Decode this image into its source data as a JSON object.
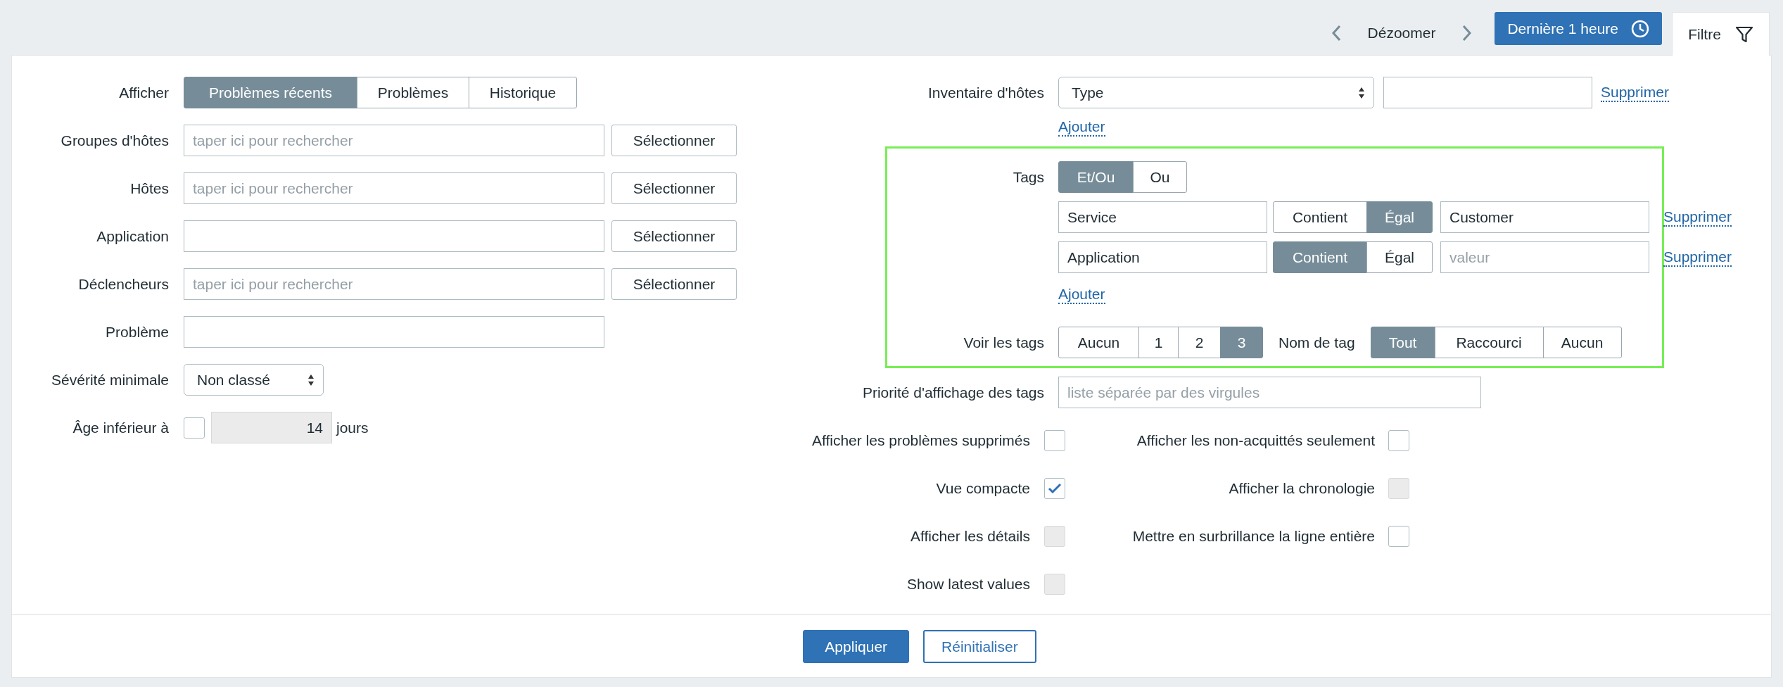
{
  "header": {
    "zoom_out": "Dézoomer",
    "time_range": "Dernière 1 heure",
    "filter_tab": "Filtre"
  },
  "left": {
    "show": {
      "label": "Afficher",
      "options": [
        {
          "label": "Problèmes récents",
          "selected": true
        },
        {
          "label": "Problèmes",
          "selected": false
        },
        {
          "label": "Historique",
          "selected": false
        }
      ]
    },
    "fields": [
      {
        "kind": "multiselect",
        "label": "Groupes d'hôtes",
        "placeholder": "taper ici pour rechercher",
        "button": "Sélectionner"
      },
      {
        "kind": "multiselect",
        "label": "Hôtes",
        "placeholder": "taper ici pour rechercher",
        "button": "Sélectionner"
      },
      {
        "kind": "multiselect",
        "label": "Application",
        "button": "Sélectionner"
      },
      {
        "kind": "multiselect",
        "label": "Déclencheurs",
        "placeholder": "taper ici pour rechercher",
        "button": "Sélectionner"
      },
      {
        "kind": "text",
        "label": "Problème"
      },
      {
        "kind": "select",
        "label": "Sévérité minimale",
        "value": "Non classé"
      },
      {
        "kind": "age",
        "label": "Âge inférieur à",
        "checked": false,
        "value": "14",
        "disabled": true,
        "unit": "jours"
      }
    ]
  },
  "right": {
    "inventory": {
      "label": "Inventaire d'hôtes",
      "field": "Type",
      "remove": "Supprimer",
      "add": "Ajouter"
    },
    "tags": {
      "label": "Tags",
      "evaltype": [
        {
          "label": "Et/Ou",
          "selected": true
        },
        {
          "label": "Ou",
          "selected": false
        }
      ],
      "rows": [
        {
          "tag": "Service",
          "operators": [
            {
              "label": "Contient",
              "selected": false
            },
            {
              "label": "Égal",
              "selected": true
            }
          ],
          "value": "Customer",
          "remove": "Supprimer"
        },
        {
          "tag": "Application",
          "operators": [
            {
              "label": "Contient",
              "selected": true
            },
            {
              "label": "Égal",
              "selected": false
            }
          ],
          "placeholder": "valeur",
          "remove": "Supprimer"
        }
      ],
      "add": "Ajouter",
      "show_tags": {
        "label": "Voir les tags",
        "options": [
          {
            "label": "Aucun",
            "selected": false
          },
          {
            "label": "1",
            "selected": false
          },
          {
            "label": "2",
            "selected": false
          },
          {
            "label": "3",
            "selected": true
          }
        ]
      },
      "tag_name": {
        "label": "Nom de tag",
        "options": [
          {
            "label": "Tout",
            "selected": true
          },
          {
            "label": "Raccourci",
            "selected": false
          },
          {
            "label": "Aucun",
            "selected": false
          }
        ]
      }
    },
    "priority": {
      "label": "Priorité d'affichage des tags",
      "placeholder": "liste séparée par des virgules"
    },
    "checkbox_rows": [
      [
        {
          "label": "Afficher les problèmes supprimés",
          "checked": false,
          "disabled": false
        },
        {
          "label": "Afficher les non-acquittés seulement",
          "checked": false,
          "disabled": false
        }
      ],
      [
        {
          "label": "Vue compacte",
          "checked": true,
          "disabled": false
        },
        {
          "label": "Afficher la chronologie",
          "checked": false,
          "disabled": true
        }
      ],
      [
        {
          "label": "Afficher les détails",
          "checked": false,
          "disabled": true
        },
        {
          "label": "Mettre en surbrillance la ligne entière",
          "checked": false,
          "disabled": false
        }
      ],
      [
        {
          "label": "Show latest values",
          "checked": false,
          "disabled": true
        }
      ]
    ]
  },
  "footer": {
    "apply": "Appliquer",
    "reset": "Réinitialiser"
  }
}
